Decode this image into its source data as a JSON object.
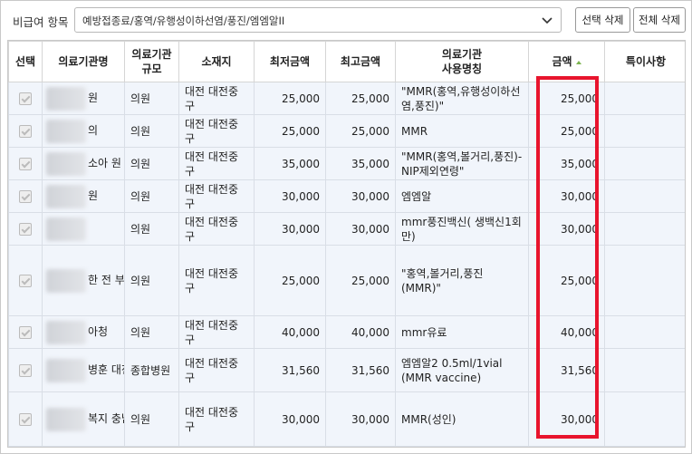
{
  "filter": {
    "label": "비급여 항목",
    "selected": "예방접종료/홍역/유행성이하선염/풍진/엠엠알II"
  },
  "toolbar": {
    "select_delete_label": "선택 삭제",
    "delete_all_label": "전체 삭제"
  },
  "table": {
    "headers": {
      "select": "선택",
      "name": "의료기관명",
      "scale": "의료기관\n규모",
      "location": "소재지",
      "min": "최저금액",
      "max": "최고금액",
      "usage_name": "의료기관\n사용명칭",
      "amount": "금액",
      "remarks": "특이사항"
    },
    "rows": [
      {
        "name": "원",
        "scale": "의원",
        "location": "대전 대전중구",
        "min": "25,000",
        "max": "25,000",
        "usage": "\"MMR(홍역,유행성이하선염,풍진)\"",
        "amount": "25,000"
      },
      {
        "name": "의",
        "scale": "의원",
        "location": "대전 대전중구",
        "min": "25,000",
        "max": "25,000",
        "usage": "MMR",
        "amount": "25,000"
      },
      {
        "name": "소아 원",
        "scale": "의원",
        "location": "대전 대전중구",
        "min": "35,000",
        "max": "35,000",
        "usage": "\"MMR(홍역,볼거리,풍진)-NIP제외연령\"",
        "amount": "35,000"
      },
      {
        "name": "원",
        "scale": "의원",
        "location": "대전 대전중구",
        "min": "30,000",
        "max": "30,000",
        "usage": "엠엠알",
        "amount": "30,000"
      },
      {
        "name": "",
        "scale": "의원",
        "location": "대전 대전중구",
        "min": "30,000",
        "max": "30,000",
        "usage": "mmr풍진백신( 생백신1회만)",
        "amount": "30,000"
      },
      {
        "name": "한 전 부 의",
        "scale": "의원",
        "location": "대전 대전중구",
        "min": "25,000",
        "max": "25,000",
        "usage": "\"홍역,볼거리,풍진(MMR)\"",
        "amount": "25,000"
      },
      {
        "name": "아청",
        "scale": "의원",
        "location": "대전 대전중구",
        "min": "40,000",
        "max": "40,000",
        "usage": "mmr유료",
        "amount": "40,000"
      },
      {
        "name": "병훈 대전",
        "scale": "종합병원",
        "location": "대전 대전중구",
        "min": "31,560",
        "max": "31,560",
        "usage": "엠엠알2 0.5ml/1vial (MMR vaccine)",
        "amount": "31,560"
      },
      {
        "name": "복지 충남 보건",
        "scale": "의원",
        "location": "대전 대전중구",
        "min": "30,000",
        "max": "30,000",
        "usage": "MMR(성인)",
        "amount": "30,000"
      }
    ]
  },
  "colors": {
    "highlight_box": "#e8142d",
    "row_bg": "#f1f5fb",
    "sort_arrow": "#7bb34f"
  }
}
